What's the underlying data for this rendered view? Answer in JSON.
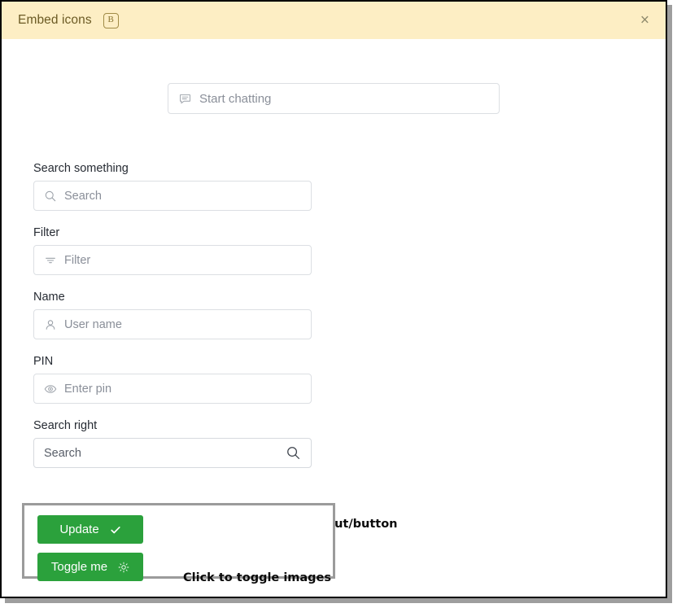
{
  "banner": {
    "title": "Embed icons",
    "badge": "B",
    "close_label": "×",
    "close_icon": "close-icon",
    "background": "#fdeec4",
    "text_color": "#6b5a24"
  },
  "chat": {
    "placeholder": "Start chatting",
    "icon": "chat-bubble-icon"
  },
  "fields": [
    {
      "label": "Search something",
      "placeholder": "Search",
      "icon": "search-icon",
      "icon_side": "left",
      "name": "search-something"
    },
    {
      "label": "Filter",
      "placeholder": "Filter",
      "icon": "filter-icon",
      "icon_side": "left",
      "name": "filter"
    },
    {
      "label": "Name",
      "placeholder": "User name",
      "icon": "user-icon",
      "icon_side": "left",
      "name": "name"
    },
    {
      "label": "PIN",
      "placeholder": "Enter pin",
      "icon": "eye-icon",
      "icon_side": "left",
      "name": "pin"
    },
    {
      "label": "Search right",
      "placeholder": "Search",
      "icon": "search-icon",
      "icon_side": "right",
      "name": "search-right"
    }
  ],
  "annotations": {
    "input_button": "Input/button",
    "click_to_toggle": "Click to toggle images"
  },
  "buttons": {
    "update": {
      "label": "Update",
      "icon": "check-icon",
      "color": "#2ba13c"
    },
    "toggle": {
      "label": "Toggle me",
      "icon": "sun-icon",
      "color": "#2ba13c"
    }
  }
}
